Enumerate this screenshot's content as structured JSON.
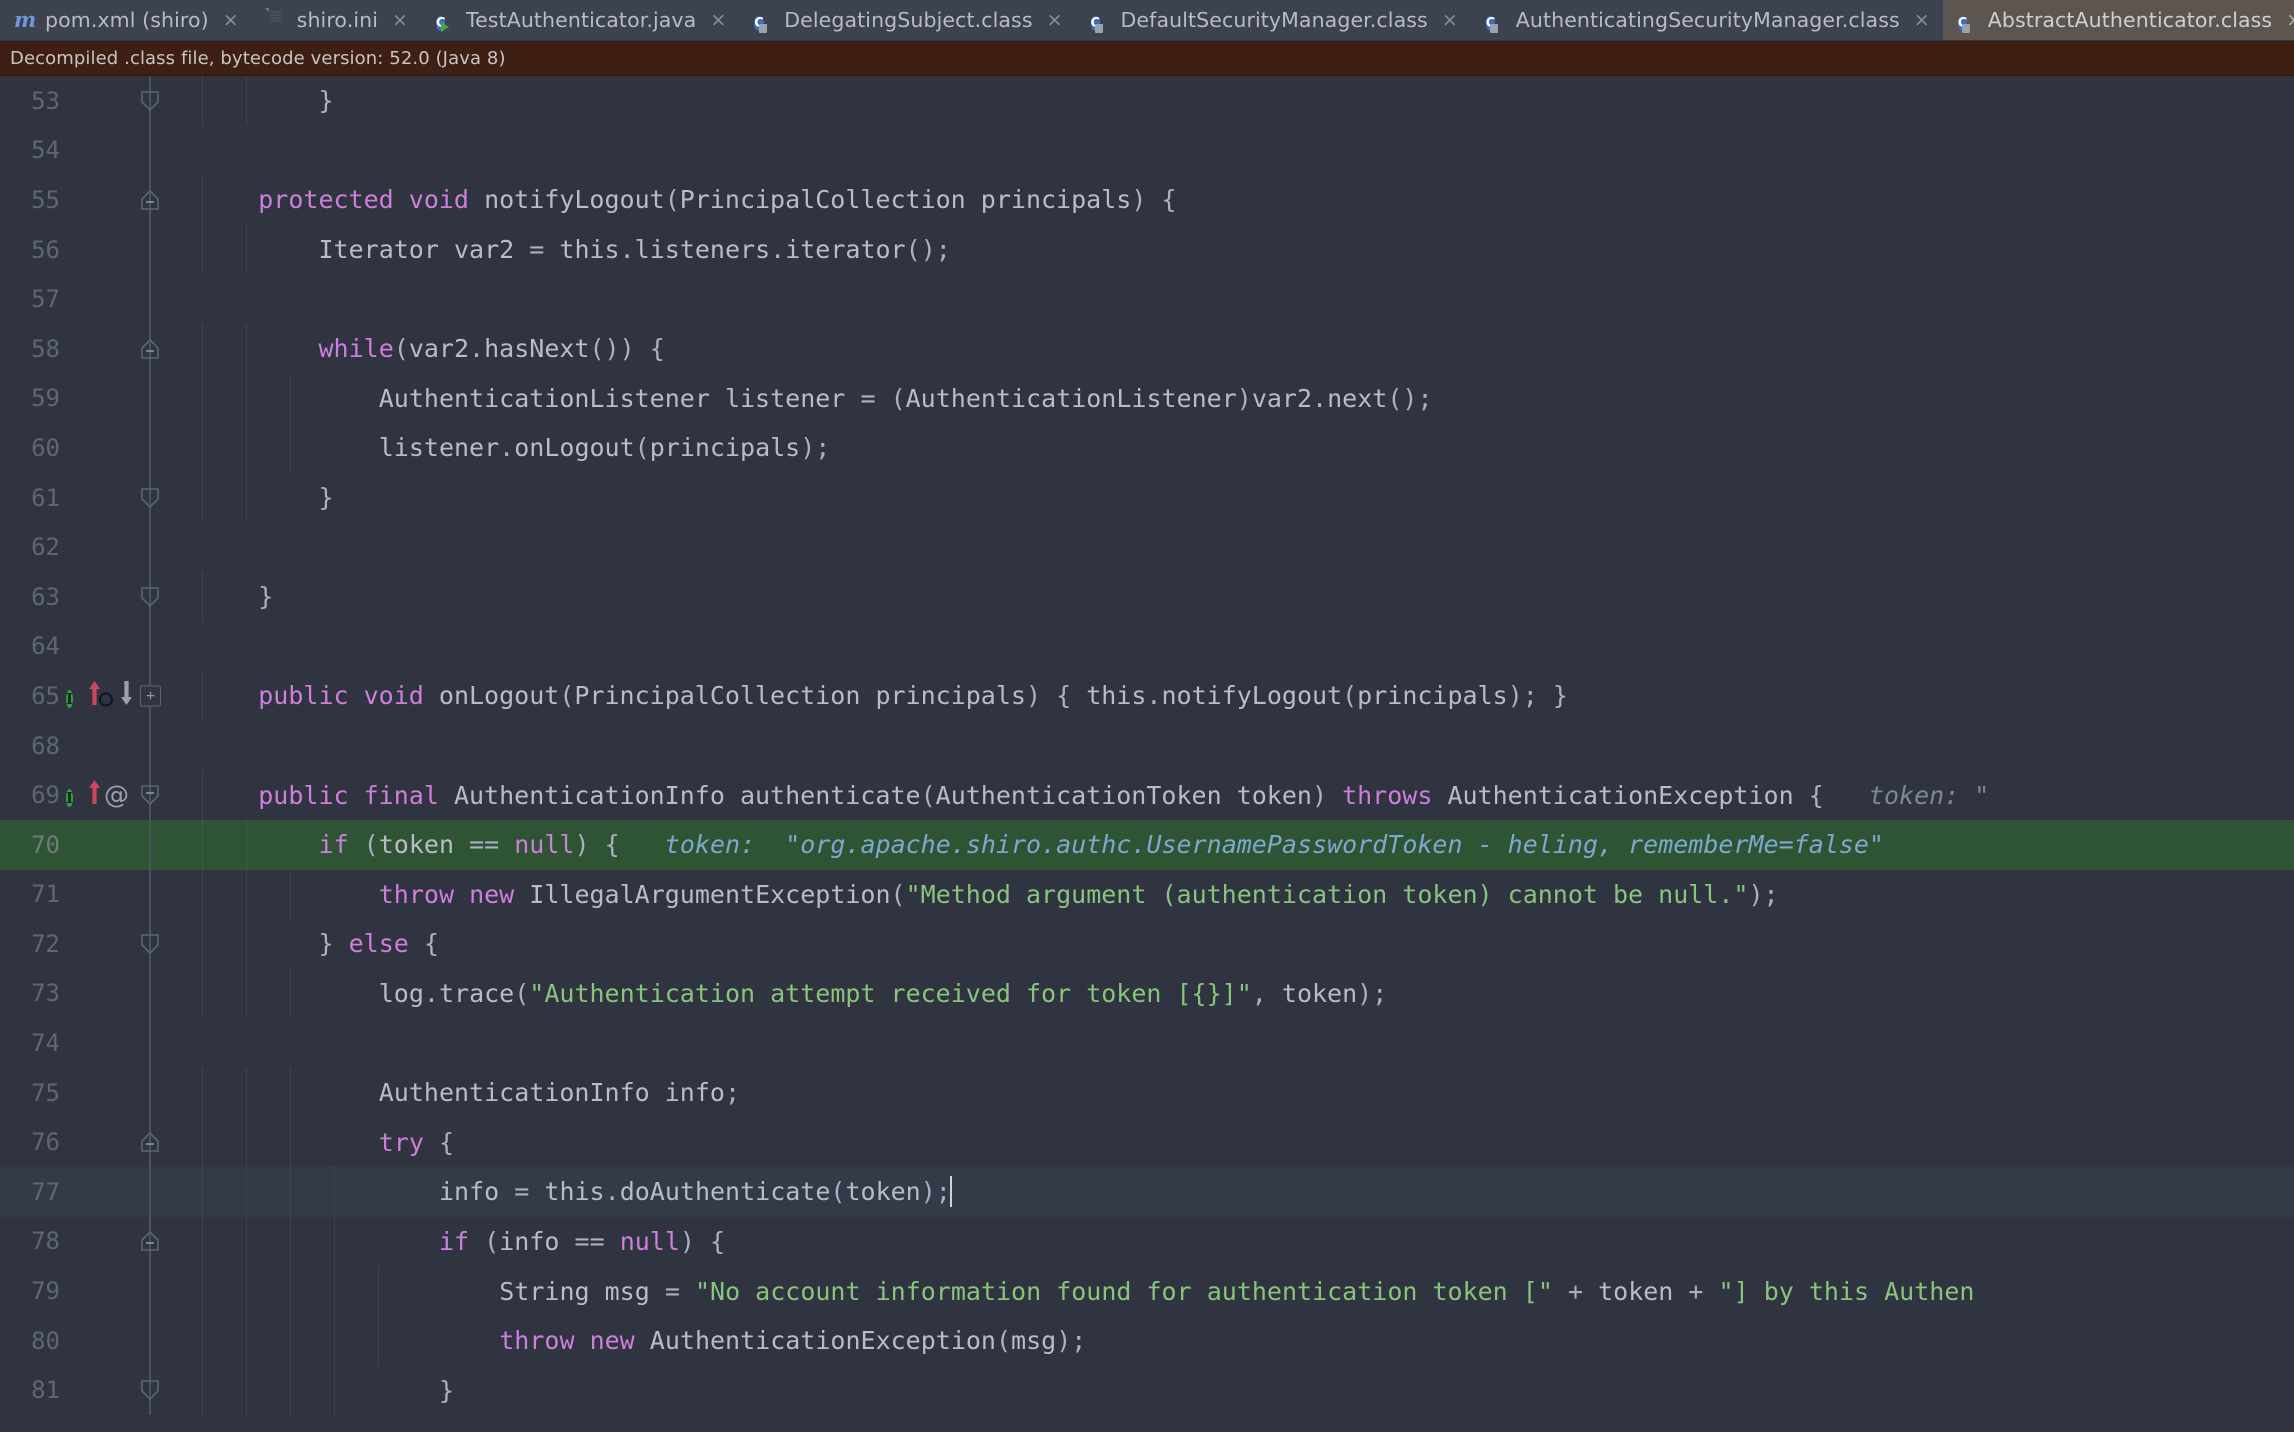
{
  "tabs": [
    {
      "label": "pom.xml (shiro)",
      "icon": "maven-icon",
      "active": false,
      "close": "×"
    },
    {
      "label": "shiro.ini",
      "icon": "ini-file-icon",
      "active": false,
      "close": "×"
    },
    {
      "label": "TestAuthenticator.java",
      "icon": "java-runnable-class-icon",
      "active": false,
      "close": "×"
    },
    {
      "label": "DelegatingSubject.class",
      "icon": "java-class-file-icon",
      "active": false,
      "close": "×"
    },
    {
      "label": "DefaultSecurityManager.class",
      "icon": "java-class-file-icon",
      "active": false,
      "close": "×"
    },
    {
      "label": "AuthenticatingSecurityManager.class",
      "icon": "java-class-file-icon",
      "active": false,
      "close": "×"
    },
    {
      "label": "AbstractAuthenticator.class",
      "icon": "java-class-file-icon",
      "active": true,
      "close": "×"
    }
  ],
  "banner": {
    "text": "Decompiled .class file, bytecode version: 52.0 (Java 8)"
  },
  "editor": {
    "language": "java",
    "colors": {
      "background": "#2f3440",
      "line_number": "#5f6673",
      "execution_line": "#2f5434",
      "caret_line": "#343a47",
      "keyword": "#cc7fdb",
      "string": "#89c47d",
      "identifier": "#b7bcc8",
      "inline_hint": "#7e8797",
      "debugger_value": "#7fa8cf",
      "matched_brace": "#e6d84a",
      "banner_background": "#3d1f14",
      "tab_active_background": "#5d5650"
    },
    "lines": [
      {
        "num": "53",
        "text": "        }"
      },
      {
        "num": "54",
        "text": ""
      },
      {
        "num": "55",
        "text": "    protected void notifyLogout(PrincipalCollection principals) {"
      },
      {
        "num": "56",
        "text": "        Iterator var2 = this.listeners.iterator();"
      },
      {
        "num": "57",
        "text": ""
      },
      {
        "num": "58",
        "text": "        while(var2.hasNext()) {"
      },
      {
        "num": "59",
        "text": "            AuthenticationListener listener = (AuthenticationListener)var2.next();"
      },
      {
        "num": "60",
        "text": "            listener.onLogout(principals);"
      },
      {
        "num": "61",
        "text": "        }"
      },
      {
        "num": "62",
        "text": ""
      },
      {
        "num": "63",
        "text": "    }"
      },
      {
        "num": "64",
        "text": ""
      },
      {
        "num": "65",
        "text": "    public void onLogout(PrincipalCollection principals) { this.notifyLogout(principals); }"
      },
      {
        "num": "68",
        "text": ""
      },
      {
        "num": "69",
        "text": "    public final AuthenticationInfo authenticate(AuthenticationToken token) throws AuthenticationException {",
        "hint": "token: \""
      },
      {
        "num": "70",
        "text": "        if (token == null) {",
        "debug_value": "token:  \"org.apache.shiro.authc.UsernamePasswordToken - heling, rememberMe=false\"",
        "executing": true
      },
      {
        "num": "71",
        "text": "            throw new IllegalArgumentException(\"Method argument (authentication token) cannot be null.\");"
      },
      {
        "num": "72",
        "text": "        } else {"
      },
      {
        "num": "73",
        "text": "            log.trace(\"Authentication attempt received for token [{}]\", token);"
      },
      {
        "num": "74",
        "text": ""
      },
      {
        "num": "75",
        "text": "            AuthenticationInfo info;"
      },
      {
        "num": "76",
        "text": "            try {"
      },
      {
        "num": "77",
        "text": "                info = this.doAuthenticate(token);",
        "caret": true
      },
      {
        "num": "78",
        "text": "                if (info == null) {"
      },
      {
        "num": "79",
        "text": "                    String msg = \"No account information found for authentication token [\" + token + \"] by this Authen"
      },
      {
        "num": "80",
        "text": "                    throw new AuthenticationException(msg);"
      },
      {
        "num": "81",
        "text": "                }"
      }
    ],
    "gutter_icons": {
      "line_65": [
        "implementing-method-icon",
        "overridden-method-up-arrow-icon",
        "overriding-method-icon",
        "implemented-method-down-arrow-icon"
      ],
      "line_69": [
        "implementing-method-icon",
        "overridden-method-up-arrow-icon",
        "annotation-at-icon"
      ]
    }
  }
}
